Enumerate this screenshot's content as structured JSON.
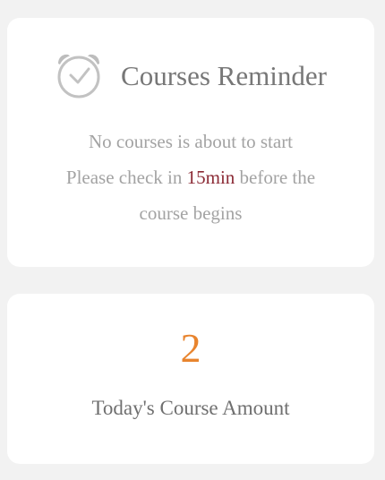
{
  "reminder": {
    "title": "Courses Reminder",
    "line1": "No courses is about to start",
    "line2_prefix": "Please check in ",
    "line2_highlight": "15min",
    "line2_suffix": " before the",
    "line3": "course begins",
    "icon": "alarm-clock-icon",
    "highlight_color": "#8b2a35"
  },
  "amount": {
    "value": "2",
    "label": "Today's Course Amount",
    "value_color": "#e8842e"
  }
}
